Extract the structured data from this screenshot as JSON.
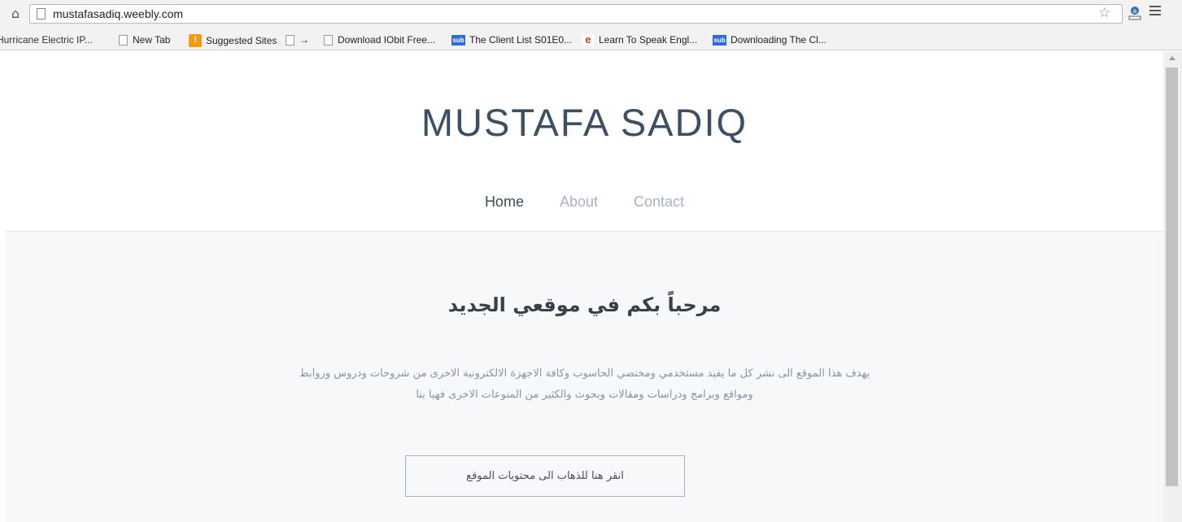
{
  "browser": {
    "url": "mustafasadiq.weebly.com",
    "bookmarks": [
      {
        "label": "Hurricane Electric IP...",
        "icon": "page-icon"
      },
      {
        "label": "New Tab",
        "icon": "page-icon"
      },
      {
        "label": "Suggested Sites",
        "icon": "suggested-sites-icon"
      },
      {
        "label": "→",
        "icon": "page-icon"
      },
      {
        "label": "Download IObit Free...",
        "icon": "page-icon"
      },
      {
        "label": "The Client List S01E0...",
        "icon": "sub-icon"
      },
      {
        "label": "Learn To Speak Engl...",
        "icon": "ie-icon"
      },
      {
        "label": "Downloading The Cl...",
        "icon": "sub-icon"
      }
    ]
  },
  "site": {
    "title": "MUSTAFA SADIQ",
    "nav": {
      "home": "Home",
      "about": "About",
      "contact": "Contact"
    },
    "hero": {
      "heading": "مرحباً بكم في موقعي الجديد",
      "desc_line1": "يهدف هذا الموقع الى نشر كل ما يفيد مستخدمي ومختصي الحاسوب وكافة الاجهزة الالكترونية الاخرى من شروحات ودروس وروابط",
      "desc_line2": "ومواقع وبرامج ودراسات ومقالات وبحوث والكثير من المنوعات الاخرى فهيا بنا",
      "button": "انقر هنا للذهاب الى محتويات الموقع"
    }
  },
  "colors": {
    "title": "#3d4f63",
    "nav_active": "#3d4a58",
    "nav_inactive": "#a9b2c2",
    "hero_bg": "#f7f8fa",
    "desc": "#8893a6"
  }
}
